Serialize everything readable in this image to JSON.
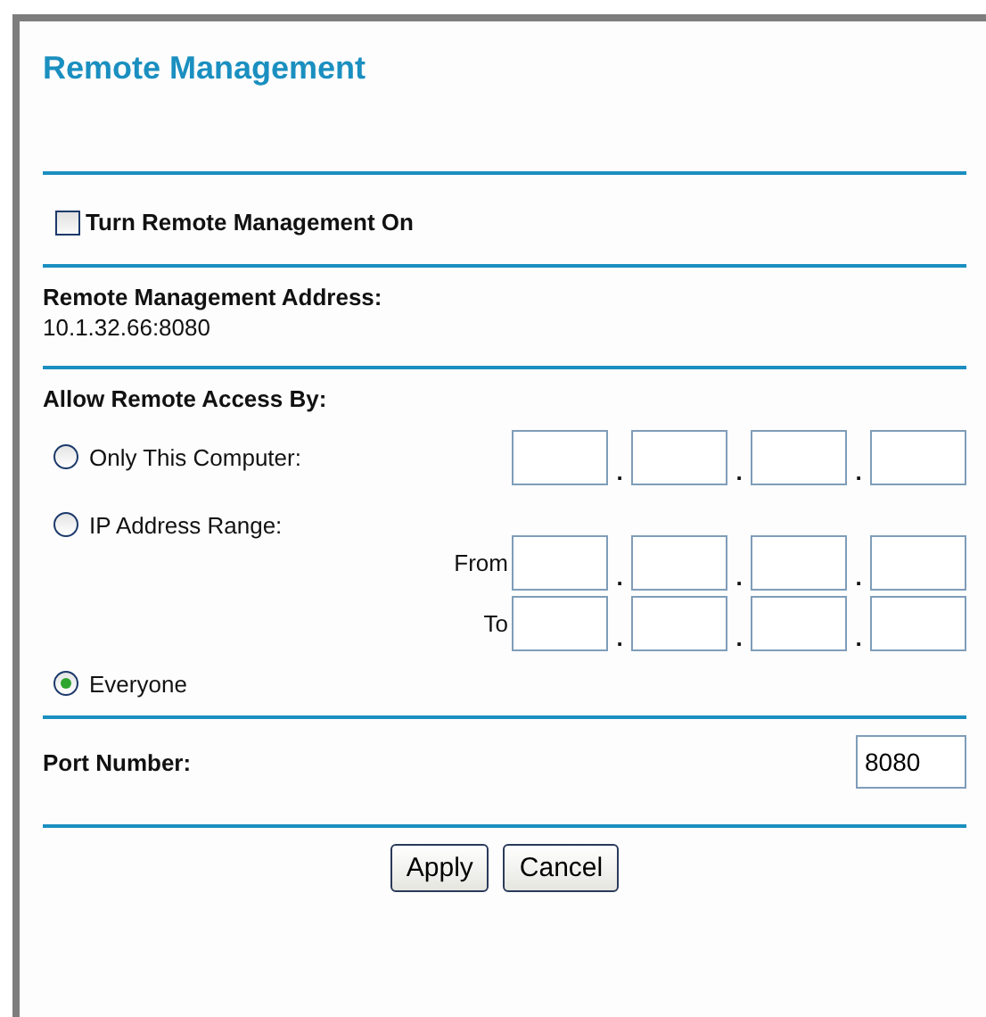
{
  "title": "Remote Management",
  "enable": {
    "label": "Turn Remote Management On",
    "checked": false
  },
  "address": {
    "label": "Remote Management Address:",
    "value": "10.1.32.66:8080"
  },
  "access": {
    "label": "Allow Remote Access By:",
    "options": [
      {
        "label": "Only This Computer:",
        "selected": false,
        "kind": "single",
        "separators": [
          ".",
          ".",
          "."
        ]
      },
      {
        "label": "IP Address Range:",
        "selected": false,
        "kind": "range",
        "rows": [
          {
            "label": "From",
            "separators": [
              ".",
              ".",
              "."
            ]
          },
          {
            "label": "To",
            "separators": [
              ".",
              ".",
              "."
            ]
          }
        ]
      },
      {
        "label": "Everyone",
        "selected": true,
        "kind": "none"
      }
    ]
  },
  "port": {
    "label": "Port Number:",
    "value": "8080"
  },
  "buttons": [
    "Apply",
    "Cancel"
  ]
}
